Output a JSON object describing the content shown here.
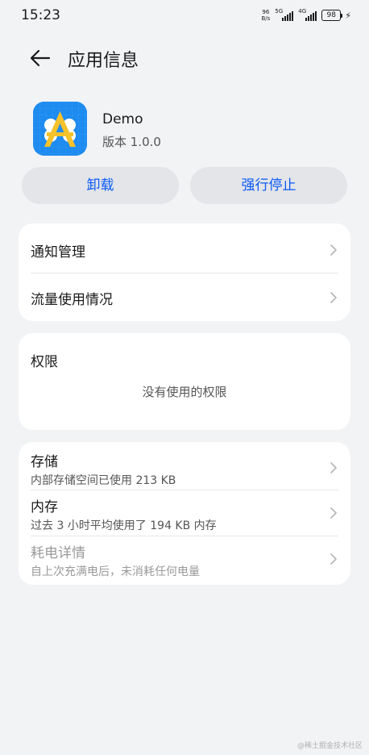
{
  "status_bar": {
    "time": "15:23",
    "net_speed_value": "96",
    "net_speed_unit": "B/s",
    "sim1_tag": "5G",
    "sim2_tag": "4G",
    "battery": "98"
  },
  "header": {
    "title": "应用信息"
  },
  "app": {
    "name": "Demo",
    "version": "版本 1.0.0"
  },
  "actions": {
    "uninstall": "卸载",
    "force_stop": "强行停止"
  },
  "nav_items": [
    {
      "label": "通知管理"
    },
    {
      "label": "流量使用情况"
    }
  ],
  "permissions": {
    "title": "权限",
    "empty_text": "没有使用的权限"
  },
  "storage_items": [
    {
      "title": "存储",
      "subtitle": "内部存储空间已使用 213 KB"
    },
    {
      "title": "内存",
      "subtitle": "过去 3 小时平均使用了 194 KB 内存"
    },
    {
      "title": "耗电详情",
      "subtitle": "自上次充满电后，未消耗任何电量"
    }
  ],
  "watermark": "@稀土掘金技术社区",
  "colors": {
    "accent": "#0a59f7",
    "app_icon_bg": "#1d8bf0",
    "app_icon_logo": "#f4c22b"
  }
}
